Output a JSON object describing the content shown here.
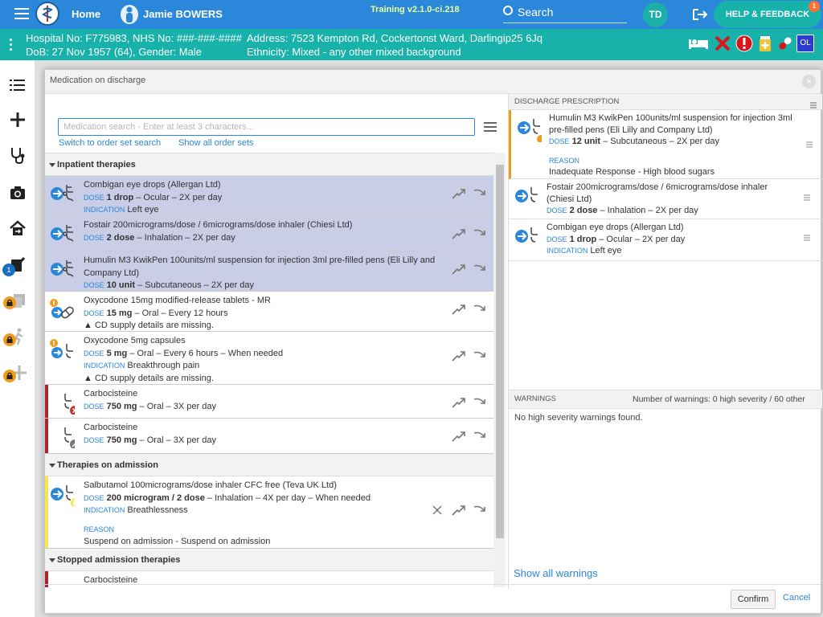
{
  "topbar": {
    "home": "Home",
    "patient_name": "Jamie BOWERS",
    "training": "Training v2.1.0-ci.218",
    "search_label": "Search",
    "user_initials": "TD",
    "help": "HELP & FEEDBACK",
    "help_badge": "1",
    "colors": {
      "bar": "#2b87d9",
      "accent": "#17b2aa"
    }
  },
  "patient": {
    "line1": "Hospital No: F775983, NHS No: ###-###-####",
    "line2": "DoB: 27 Nov 1957 (64), Gender: Male",
    "address": "Address: 7523 Kempton Rd, Cockertonst Ward, Darlingip25 6Jq",
    "ethnicity": "Ethnicity: Mixed - any other mixed background",
    "ol_badge": "OL"
  },
  "sidebar": {
    "badge": "1"
  },
  "modal": {
    "title": "Medication on discharge",
    "search_placeholder": "Medication search - Enter at least 3 characters...",
    "link_order_set": "Switch to order set search",
    "link_show_all_sets": "Show all order sets",
    "sections": {
      "inpatient": "Inpatient therapies",
      "admission": "Therapies on admission",
      "stopped": "Stopped admission therapies"
    },
    "labels": {
      "dose": "DOSE",
      "indication": "INDICATION",
      "reason": "REASON"
    },
    "rows": [
      {
        "name": "Combigan eye drops (Allergan Ltd)",
        "dose": "1 drop",
        "rest": " – Ocular – 2X per day",
        "indication": "Left eye"
      },
      {
        "name": "Fostair 200micrograms/dose / 6micrograms/dose inhaler (Chiesi Ltd)",
        "dose": "2 dose",
        "rest": " – Inhalation – 2X per day"
      },
      {
        "name": "Humulin M3 KwikPen 100units/ml suspension for injection 3ml pre-filled pens (Eli Lilly and Company Ltd)",
        "dose": "10 unit",
        "rest": " – Subcutaneous – 2X per day"
      },
      {
        "name": "Oxycodone 15mg modified-release tablets - MR",
        "dose": "15 mg",
        "rest": " – Oral – Every 12 hours",
        "warn": "CD supply details are missing."
      },
      {
        "name": "Oxycodone 5mg capsules",
        "dose": "5 mg",
        "rest": " – Oral – Every 6 hours – When needed",
        "indication": "Breakthrough pain",
        "warn": "CD supply details are missing."
      },
      {
        "name": "Carbocisteine",
        "dose": "750 mg",
        "rest": " – Oral – 3X per day"
      },
      {
        "name": "Carbocisteine",
        "dose": "750 mg",
        "rest": " – Oral – 3X per day"
      },
      {
        "name": "Salbutamol 100micrograms/dose inhaler CFC free (Teva UK Ltd)",
        "dose": "200 microgram / 2 dose",
        "rest": " – Inhalation – 4X per day – When needed",
        "indication": "Breathlessness",
        "reason": "Suspend on admission - Suspend on admission"
      },
      {
        "name": "Carbocisteine"
      }
    ],
    "discharge": {
      "header": "DISCHARGE PRESCRIPTION",
      "items": [
        {
          "name": "Humulin M3 KwikPen 100units/ml suspension for injection 3ml pre-filled pens (Eli Lilly and Company Ltd)",
          "dose": "12 unit",
          "rest": " – Subcutaneous – 2X per day",
          "reason": "Inadequate Response - High blood sugars"
        },
        {
          "name": "Fostair 200micrograms/dose / 6micrograms/dose inhaler (Chiesi Ltd)",
          "dose": "2 dose",
          "rest": " – Inhalation – 2X per day"
        },
        {
          "name": "Combigan eye drops (Allergan Ltd)",
          "dose": "1 drop",
          "rest": " – Ocular – 2X per day",
          "indication": "Left eye"
        }
      ]
    },
    "warnings": {
      "header": "WARNINGS",
      "count": "Number of warnings: 0 high severity / 60 other",
      "none": "No high severity warnings found.",
      "show_all": "Show all warnings"
    },
    "confirm": "Confirm",
    "cancel": "Cancel"
  }
}
